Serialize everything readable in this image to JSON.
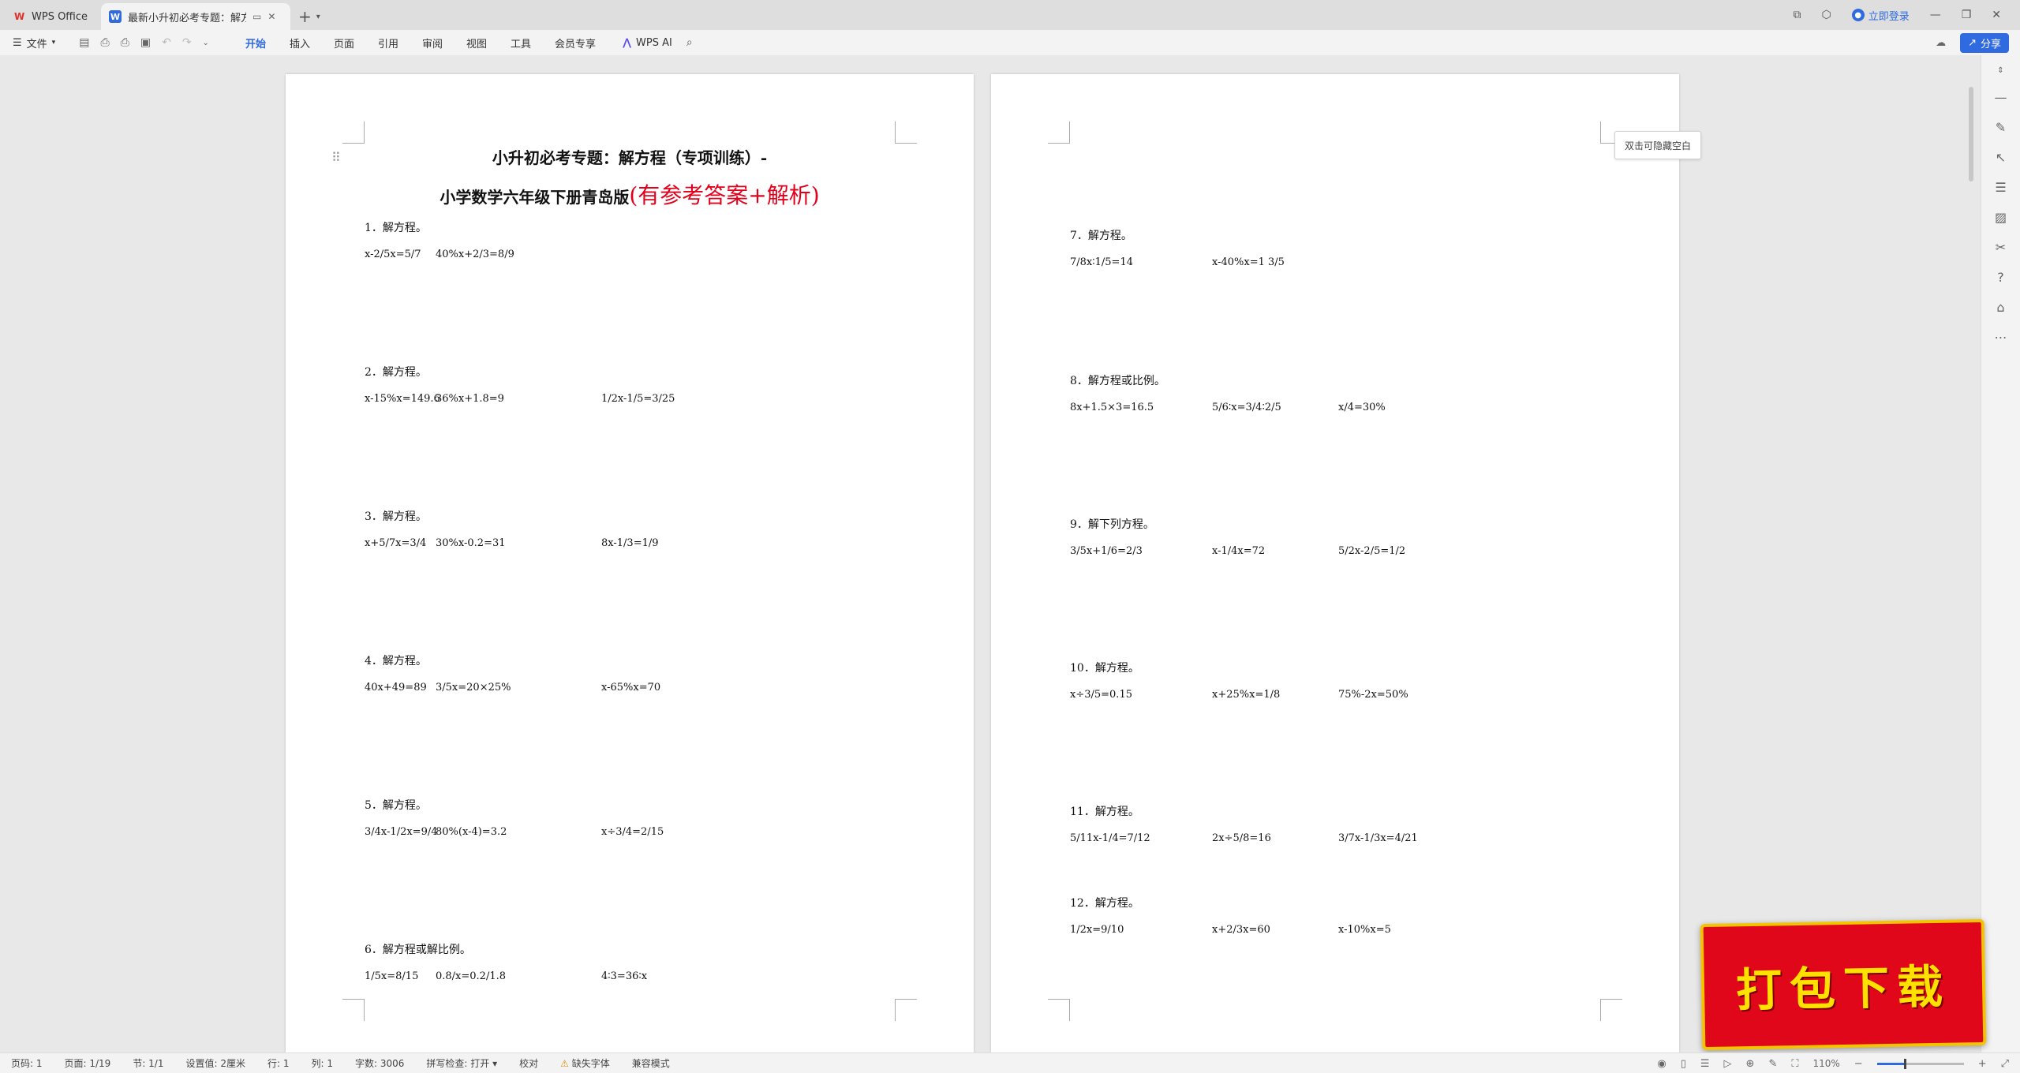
{
  "window": {
    "home_tab": "WPS Office",
    "doc_tab": "最新小升初必考专题：解方程",
    "login": "立即登录"
  },
  "ribbon": {
    "file": "文件",
    "tabs": [
      "开始",
      "插入",
      "页面",
      "引用",
      "审阅",
      "视图",
      "工具",
      "会员专享"
    ],
    "active_tab": "开始",
    "ai": "WPS AI",
    "share": "分享"
  },
  "document": {
    "title_line1": "小升初必考专题：解方程（专项训练）-",
    "title_line2": "小学数学六年级下册青岛版",
    "title_red": "(有参考答案+解析)",
    "hide_blank_tip": "双击可隐藏空白",
    "questions_page1": [
      {
        "label": "1．解方程。",
        "eqs": [
          "x-2/5x=5/7",
          "40%x+2/3=8/9"
        ]
      },
      {
        "label": "2．解方程。",
        "eqs": [
          "x-15%x=149.6",
          "36%x+1.8=9",
          "1/2x-1/5=3/25"
        ]
      },
      {
        "label": "3．解方程。",
        "eqs": [
          "x+5/7x=3/4",
          "30%x-0.2=31",
          "8x-1/3=1/9"
        ]
      },
      {
        "label": "4．解方程。",
        "eqs": [
          "40x+49=89",
          "3/5x=20×25%",
          "x-65%x=70"
        ]
      },
      {
        "label": "5．解方程。",
        "eqs": [
          "3/4x-1/2x=9/4",
          "80%(x-4)=3.2",
          "x÷3/4=2/15"
        ]
      },
      {
        "label": "6．解方程或解比例。",
        "eqs": [
          "1/5x=8/15",
          "0.8/x=0.2/1.8",
          "4∶3=36∶x"
        ]
      }
    ],
    "questions_page2": [
      {
        "label": "7．解方程。",
        "eqs": [
          "7/8x∶1/5=14",
          "x-40%x=1 3/5"
        ]
      },
      {
        "label": "8．解方程或比例。",
        "eqs": [
          "8x+1.5×3=16.5",
          "5/6∶x=3/4∶2/5",
          "x/4=30%"
        ]
      },
      {
        "label": "9．解下列方程。",
        "eqs": [
          "3/5x+1/6=2/3",
          "x-1/4x=72",
          "5/2x-2/5=1/2"
        ]
      },
      {
        "label": "10．解方程。",
        "eqs": [
          "x÷3/5=0.15",
          "x+25%x=1/8",
          "75%-2x=50%"
        ]
      },
      {
        "label": "11．解方程。",
        "eqs": [
          "5/11x-1/4=7/12",
          "2x÷5/8=16",
          "3/7x-1/3x=4/21"
        ]
      },
      {
        "label": "12．解方程。",
        "eqs": [
          "1/2x=9/10",
          "x+2/3x=60",
          "x-10%x=5"
        ]
      }
    ]
  },
  "promo": "打包下载",
  "status": {
    "page": "页码: 1",
    "pages": "页面: 1/19",
    "section": "节: 1/1",
    "setting": "设置值: 2厘米",
    "row": "行: 1",
    "col": "列: 1",
    "words": "字数: 3006",
    "spell": "拼写检查: 打开",
    "proof": "校对",
    "missing_font": "缺失字体",
    "compat": "兼容模式",
    "zoom": "110%",
    "zoom_fraction": 0.31
  },
  "colors": {
    "accent": "#2f6ae0",
    "title_red": "#e3001b",
    "promo_bg": "#e1071a",
    "promo_text": "#ffe100"
  }
}
